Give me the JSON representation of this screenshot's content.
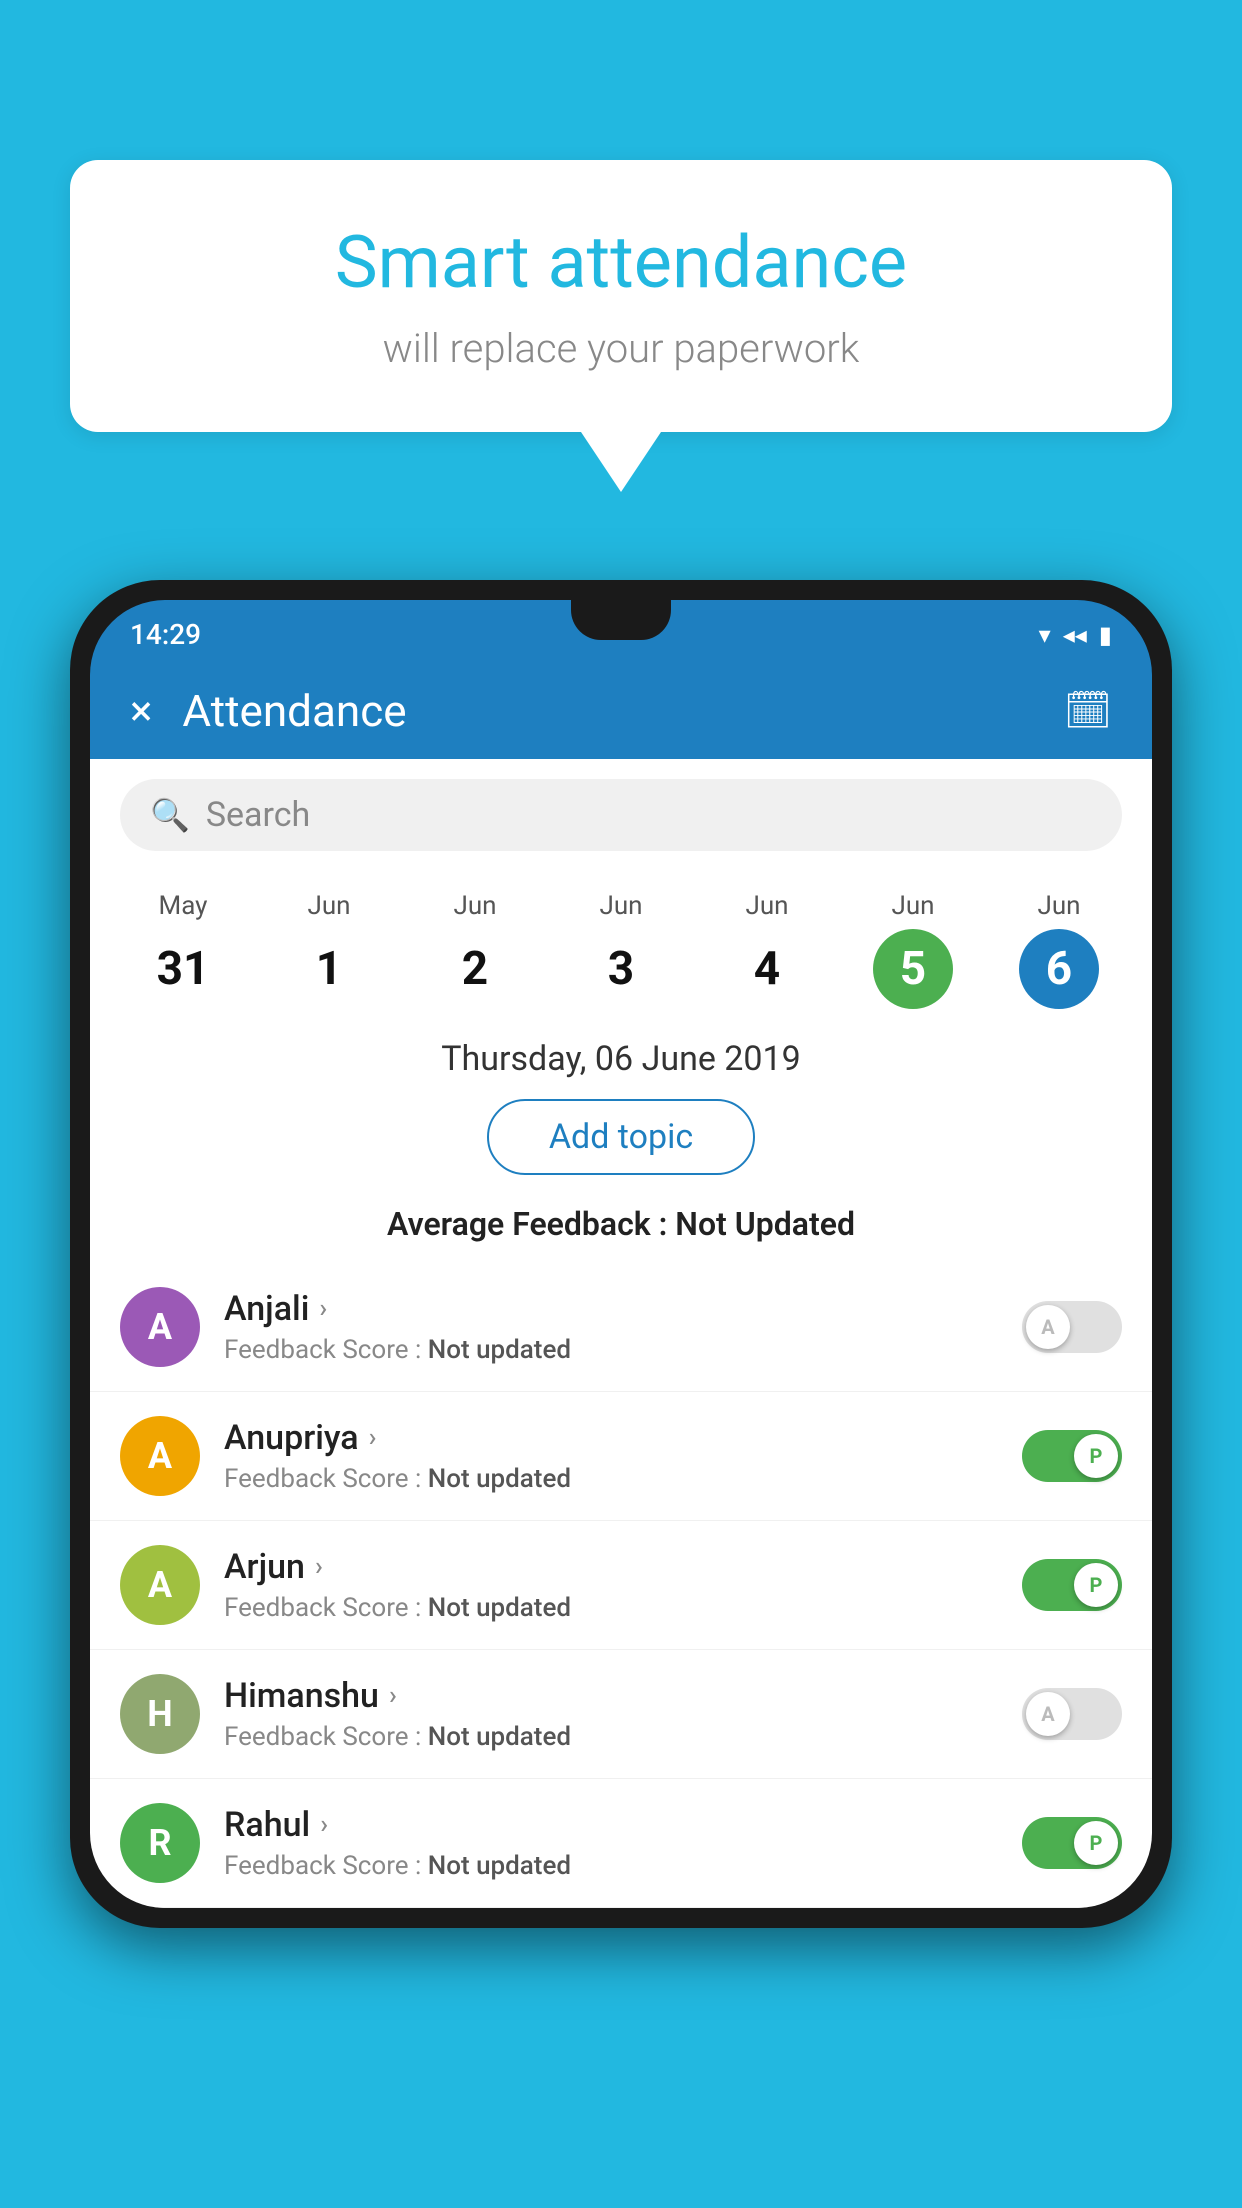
{
  "background": "#22b8e0",
  "speech_bubble": {
    "title": "Smart attendance",
    "subtitle": "will replace your paperwork"
  },
  "status_bar": {
    "time": "14:29",
    "wifi_icon": "▾",
    "signal_icon": "◂",
    "battery_icon": "▮"
  },
  "app_bar": {
    "close_label": "×",
    "title": "Attendance",
    "calendar_icon": "📅"
  },
  "search": {
    "placeholder": "Search"
  },
  "calendar": {
    "days": [
      {
        "month": "May",
        "date": "31",
        "style": "normal"
      },
      {
        "month": "Jun",
        "date": "1",
        "style": "normal"
      },
      {
        "month": "Jun",
        "date": "2",
        "style": "normal"
      },
      {
        "month": "Jun",
        "date": "3",
        "style": "normal"
      },
      {
        "month": "Jun",
        "date": "4",
        "style": "normal"
      },
      {
        "month": "Jun",
        "date": "5",
        "style": "green"
      },
      {
        "month": "Jun",
        "date": "6",
        "style": "blue"
      }
    ]
  },
  "date_header": "Thursday, 06 June 2019",
  "add_topic_label": "Add topic",
  "avg_feedback_label": "Average Feedback :",
  "avg_feedback_value": "Not Updated",
  "students": [
    {
      "name": "Anjali",
      "avatar_letter": "A",
      "avatar_color": "#9b59b6",
      "feedback_label": "Feedback Score :",
      "feedback_value": "Not updated",
      "toggle_state": "off",
      "toggle_label": "A"
    },
    {
      "name": "Anupriya",
      "avatar_letter": "A",
      "avatar_color": "#f0a500",
      "feedback_label": "Feedback Score :",
      "feedback_value": "Not updated",
      "toggle_state": "on",
      "toggle_label": "P"
    },
    {
      "name": "Arjun",
      "avatar_letter": "A",
      "avatar_color": "#a0c040",
      "feedback_label": "Feedback Score :",
      "feedback_value": "Not updated",
      "toggle_state": "on",
      "toggle_label": "P"
    },
    {
      "name": "Himanshu",
      "avatar_letter": "H",
      "avatar_color": "#90a870",
      "feedback_label": "Feedback Score :",
      "feedback_value": "Not updated",
      "toggle_state": "off",
      "toggle_label": "A"
    },
    {
      "name": "Rahul",
      "avatar_letter": "R",
      "avatar_color": "#4caf50",
      "feedback_label": "Feedback Score :",
      "feedback_value": "Not updated",
      "toggle_state": "on",
      "toggle_label": "P"
    }
  ]
}
